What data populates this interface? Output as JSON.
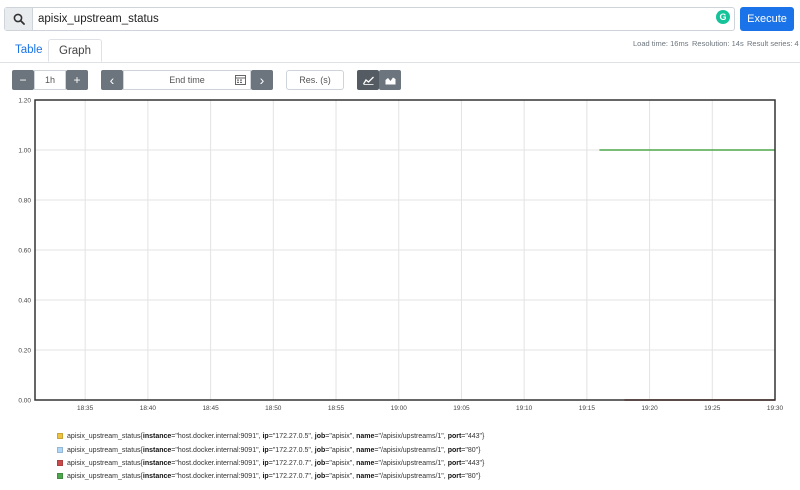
{
  "query": {
    "value": "apisix_upstream_status"
  },
  "execute_label": "Execute",
  "tabs": [
    {
      "label": "Table"
    },
    {
      "label": "Graph"
    }
  ],
  "stats": {
    "load_time": "Load time: 16ms",
    "resolution": "Resolution: 14s",
    "result_series": "Result series: 4"
  },
  "controls": {
    "minus": "−",
    "range": "1h",
    "plus": "+",
    "prev": "‹",
    "end_time_placeholder": "End time",
    "next": "›",
    "resolution_placeholder": "Res. (s)"
  },
  "colors": {
    "series": [
      "#edc240",
      "#afd8f8",
      "#cb4b4b",
      "#4da74d"
    ],
    "button": "#6c757d",
    "primary": "#1a73e8"
  },
  "chart_data": {
    "type": "line",
    "x_ticks": [
      "18:35",
      "18:40",
      "18:45",
      "18:50",
      "18:55",
      "19:00",
      "19:05",
      "19:10",
      "19:15",
      "19:20",
      "19:25",
      "19:30"
    ],
    "y_ticks": [
      "0.00",
      "0.20",
      "0.40",
      "0.60",
      "0.80",
      "1.00",
      "1.20"
    ],
    "ylim": [
      0,
      1.2
    ],
    "xlim": [
      "18:31",
      "19:30"
    ],
    "grid": true,
    "series": [
      {
        "name": "apisix_upstream_status{instance=\"host.docker.internal:9091\", ip=\"172.27.0.5\", job=\"apisix\", name=\"/apisix/upstreams/1\", port=\"443\"}",
        "x": [
          "19:18",
          "19:30"
        ],
        "values": [
          0,
          0
        ]
      },
      {
        "name": "apisix_upstream_status{instance=\"host.docker.internal:9091\", ip=\"172.27.0.5\", job=\"apisix\", name=\"/apisix/upstreams/1\", port=\"80\"}",
        "x": [
          "19:18",
          "19:30"
        ],
        "values": [
          0,
          0
        ]
      },
      {
        "name": "apisix_upstream_status{instance=\"host.docker.internal:9091\", ip=\"172.27.0.7\", job=\"apisix\", name=\"/apisix/upstreams/1\", port=\"443\"}",
        "x": [
          "19:18",
          "19:30"
        ],
        "values": [
          0,
          0
        ]
      },
      {
        "name": "apisix_upstream_status{instance=\"host.docker.internal:9091\", ip=\"172.27.0.7\", job=\"apisix\", name=\"/apisix/upstreams/1\", port=\"80\"}",
        "x": [
          "19:16",
          "19:30"
        ],
        "values": [
          1,
          1
        ]
      }
    ]
  },
  "legend": [
    {
      "metric": "apisix_upstream_status{",
      "instance": "\"host.docker.internal:9091\"",
      "ip": "\"172.27.0.5\"",
      "job": "\"apisix\"",
      "name": "\"/apisix/upstreams/1\"",
      "port": "\"443\""
    },
    {
      "metric": "apisix_upstream_status{",
      "instance": "\"host.docker.internal:9091\"",
      "ip": "\"172.27.0.5\"",
      "job": "\"apisix\"",
      "name": "\"/apisix/upstreams/1\"",
      "port": "\"80\""
    },
    {
      "metric": "apisix_upstream_status{",
      "instance": "\"host.docker.internal:9091\"",
      "ip": "\"172.27.0.7\"",
      "job": "\"apisix\"",
      "name": "\"/apisix/upstreams/1\"",
      "port": "\"443\""
    },
    {
      "metric": "apisix_upstream_status{",
      "instance": "\"host.docker.internal:9091\"",
      "ip": "\"172.27.0.7\"",
      "job": "\"apisix\"",
      "name": "\"/apisix/upstreams/1\"",
      "port": "\"80\""
    }
  ]
}
